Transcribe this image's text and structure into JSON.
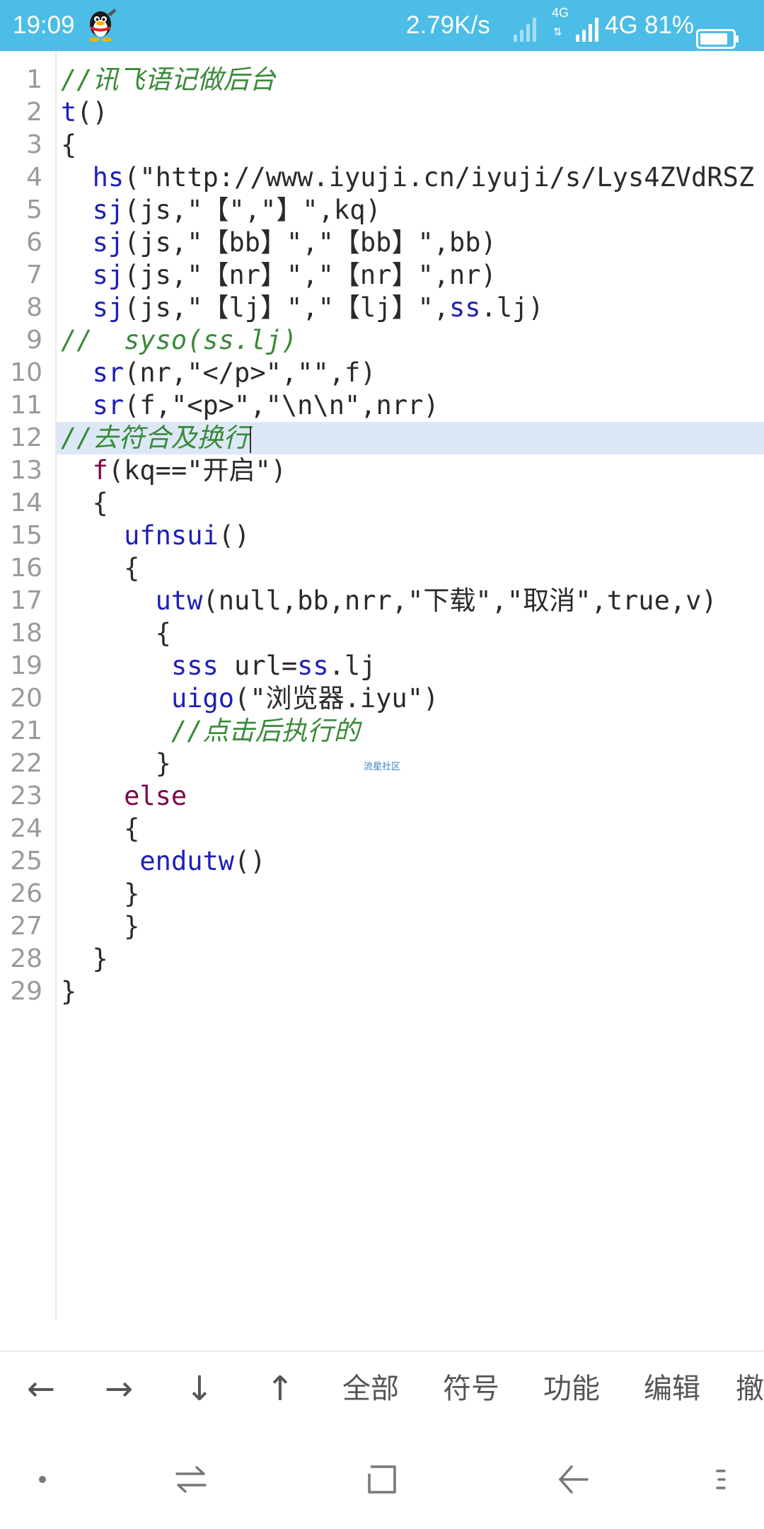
{
  "status_bar": {
    "time": "19:09",
    "speed": "2.79K/s",
    "net_small": "4G",
    "net_arrows": "⇅",
    "network": "4G",
    "battery": "81%",
    "app_icon": "qq-penguin-icon"
  },
  "editor": {
    "highlighted_line": 12,
    "lines": [
      {
        "n": "1",
        "code": "//讯飞语记做后台"
      },
      {
        "n": "2",
        "code": "t()"
      },
      {
        "n": "3",
        "code": "{"
      },
      {
        "n": "4",
        "code": "  hs(\"http://www.iyuji.cn/iyuji/s/Lys4ZVdRSZ"
      },
      {
        "n": "5",
        "code": "  sj(js,\"【\",\"】\",kq)"
      },
      {
        "n": "6",
        "code": "  sj(js,\"【bb】\",\"【bb】\",bb)"
      },
      {
        "n": "7",
        "code": "  sj(js,\"【nr】\",\"【nr】\",nr)"
      },
      {
        "n": "8",
        "code": "  sj(js,\"【lj】\",\"【lj】\",ss.lj)"
      },
      {
        "n": "9",
        "code": "//  syso(ss.lj)"
      },
      {
        "n": "10",
        "code": "  sr(nr,\"</p>\",\"\",f)"
      },
      {
        "n": "11",
        "code": "  sr(f,\"<p>\",\"\\n\\n\",nrr)"
      },
      {
        "n": "12",
        "code": "//去符合及换行"
      },
      {
        "n": "13",
        "code": "  f(kq==\"开启\")"
      },
      {
        "n": "14",
        "code": "  {"
      },
      {
        "n": "15",
        "code": "    ufnsui()"
      },
      {
        "n": "16",
        "code": "    {"
      },
      {
        "n": "17",
        "code": "      utw(null,bb,nrr,\"下载\",\"取消\",true,v)"
      },
      {
        "n": "18",
        "code": "      {"
      },
      {
        "n": "19",
        "code": "       sss url=ss.lj"
      },
      {
        "n": "20",
        "code": "       uigo(\"浏览器.iyu\")"
      },
      {
        "n": "21",
        "code": "       //点击后执行的"
      },
      {
        "n": "22",
        "code": "      }"
      },
      {
        "n": "23",
        "code": "    else"
      },
      {
        "n": "24",
        "code": "    {"
      },
      {
        "n": "25",
        "code": "     endutw()"
      },
      {
        "n": "26",
        "code": "    }"
      },
      {
        "n": "27",
        "code": "    }"
      },
      {
        "n": "28",
        "code": "  }"
      },
      {
        "n": "29",
        "code": "}"
      }
    ]
  },
  "watermark": "流星社区",
  "toolbar": {
    "items": [
      {
        "label": "←",
        "name": "arrow-left-button"
      },
      {
        "label": "→",
        "name": "arrow-right-button"
      },
      {
        "label": "↓",
        "name": "arrow-down-button"
      },
      {
        "label": "↑",
        "name": "arrow-up-button"
      },
      {
        "label": "全部",
        "name": "select-all-button"
      },
      {
        "label": "符号",
        "name": "symbols-button"
      },
      {
        "label": "功能",
        "name": "functions-button"
      },
      {
        "label": "编辑",
        "name": "edit-button"
      },
      {
        "label": "撤",
        "name": "undo-button"
      }
    ]
  },
  "navbar": {
    "buttons": [
      "dot-icon",
      "switch-icon",
      "home-square-icon",
      "back-icon",
      "menu-icon"
    ]
  },
  "colors": {
    "status_bar": "#4bbde6",
    "keyword": "#1d1fb8",
    "keyword_alt": "#7a0a45",
    "comment": "#3a8a3a",
    "highlight": "#dde8f6"
  }
}
